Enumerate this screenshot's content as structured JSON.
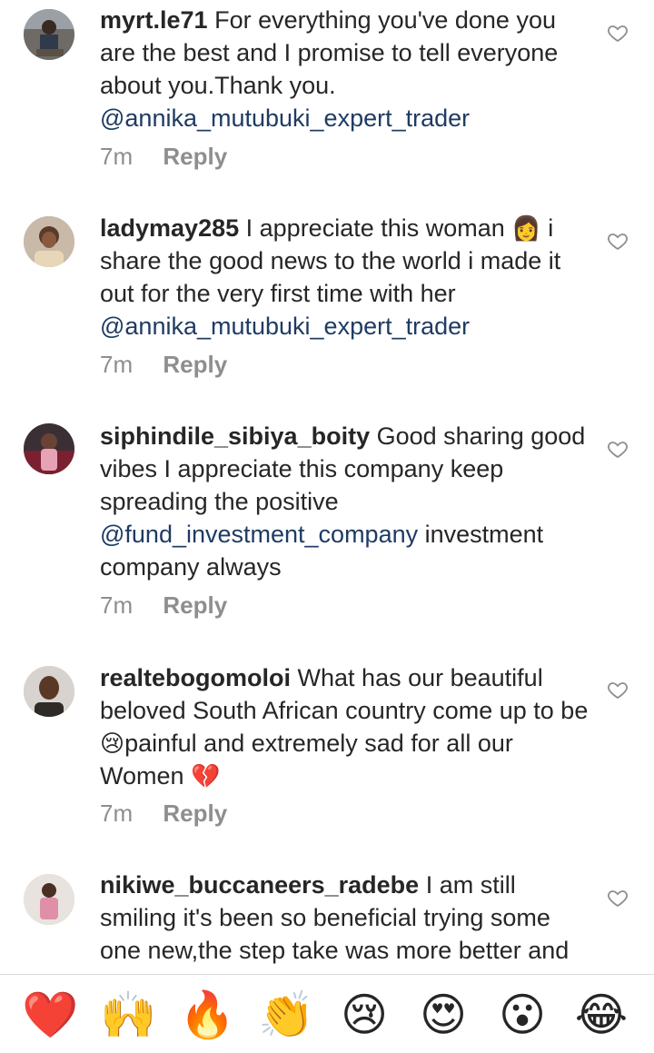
{
  "comments": [
    {
      "username": "myrt.le71",
      "text": "For everything you've done you are the best and I promise to tell everyone about you.Thank you.",
      "mention": "@annika_mutubuki_expert_trader",
      "time": "7m",
      "reply": "Reply"
    },
    {
      "username": "ladymay285",
      "text_before": "I appreciate this woman",
      "emoji": "👩",
      "text_after": "i share the good news to the world i made it out for the very first time with her",
      "mention": "@annika_mutubuki_expert_trader",
      "time": "7m",
      "reply": "Reply"
    },
    {
      "username": "siphindile_sibiya_boity",
      "text": "Good sharing good vibes I appreciate this company keep spreading the positive",
      "mention": "@fund_investment_company",
      "text_after": "investment company always",
      "time": "7m",
      "reply": "Reply"
    },
    {
      "username": "realtebogomoloi",
      "text_before": "What has our beautiful beloved South African country come up to be",
      "emoji1": "😢",
      "text_after": "painful and extremely sad for all our Women",
      "emoji2": "💔",
      "time": "7m",
      "reply": "Reply"
    },
    {
      "username": "nikiwe_buccaneers_radebe",
      "text": "I am still smiling it's been so beneficial trying some one new,the step take was more better and"
    }
  ],
  "emoji_bar": [
    "❤️",
    "🙌",
    "🔥",
    "👏",
    "😢",
    "😍",
    "😮",
    "😂"
  ],
  "icons": {
    "like": "heart-outline-icon"
  }
}
